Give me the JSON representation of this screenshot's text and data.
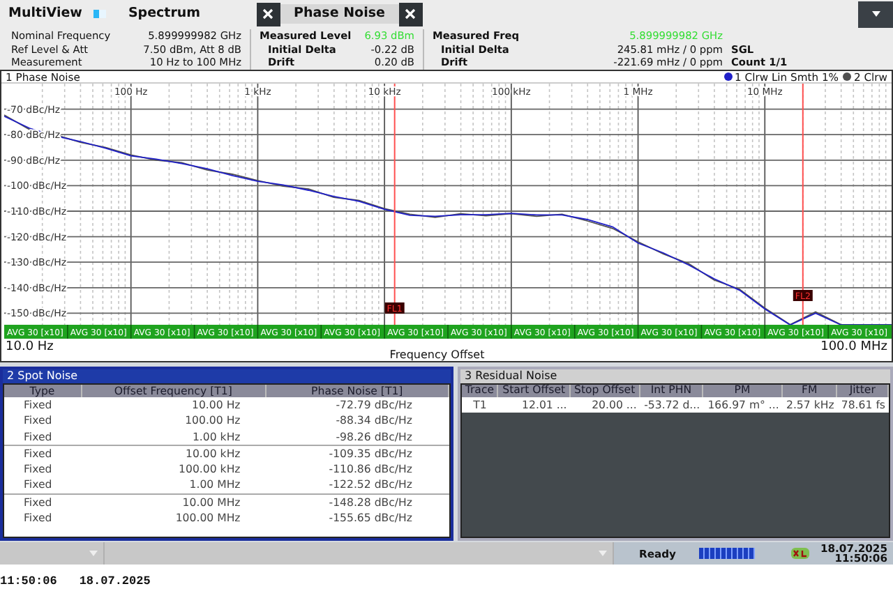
{
  "tab_bar": {
    "title": "MultiView",
    "tabs": [
      {
        "label": "Spectrum",
        "selected": false
      },
      {
        "label": "Phase Noise",
        "selected": true
      }
    ]
  },
  "info_columns": [
    [
      {
        "label": "Nominal Frequency",
        "value": "5.899999982 GHz",
        "highlighted": false
      },
      {
        "label": "Ref Level & Att",
        "value": "7.50 dBm, Att 8 dB",
        "highlighted": false
      },
      {
        "label": "Measurement",
        "value": "10 Hz to 100 MHz",
        "highlighted": false
      }
    ],
    [
      {
        "label": "Measured Level",
        "value": "6.93 dBm",
        "highlighted": true,
        "children": [
          {
            "label": "Initial Delta",
            "value": "-0.22 dB",
            "highlighted": false
          },
          {
            "label": "Drift",
            "value": "0.20 dB",
            "highlighted": false
          }
        ]
      }
    ],
    [
      {
        "label": "Measured Freq",
        "value": "5.899999982 GHz",
        "highlighted": true,
        "children": [
          {
            "label": "Initial Delta",
            "value": "245.81 mHz / 0 ppm",
            "highlighted": false
          },
          {
            "label": "Drift",
            "value": "-221.69 mHz / 0 ppm",
            "highlighted": false
          }
        ]
      }
    ],
    [
      {
        "label": "SGL"
      },
      {
        "label": "Count 1/1"
      }
    ]
  ],
  "phase_noise_window": {
    "title": "1 Phase Noise",
    "start_label": "10.0 Hz",
    "stop_label": "100.0 MHz",
    "average_labels": [
      "AVG 30 [x10]",
      "AVG 30 [x10]",
      "AVG 30 [x10]",
      "AVG 30 [x10]",
      "AVG 30 [x10]",
      "AVG 30 [x10]",
      "AVG 30 [x10]",
      "AVG 30 [x10]",
      "AVG 30 [x10]",
      "AVG 30 [x10]",
      "AVG 30 [x10]",
      "AVG 30 [x10]",
      "AVG 30 [x10]",
      "AVG 30 [x10]"
    ],
    "chart_data": {
      "type": "line",
      "xlabel": "Frequency Offset",
      "categories": [
        null,
        null,
        null,
        null,
        null,
        "100 Hz",
        null,
        null,
        null,
        null,
        "1 kHz",
        null,
        null,
        null,
        null,
        "10 kHz",
        null,
        null,
        null,
        null,
        "100 kHz",
        null,
        null,
        null,
        null,
        "1 MHz",
        null,
        null,
        null,
        null,
        "10 MHz",
        null,
        null,
        null,
        null,
        null
      ],
      "series": [
        {
          "name": "1 Clrw Lin Smth 1%",
          "color": "#2020c8",
          "values": [
            -72.8,
            -77.5,
            -80.5,
            -82.7,
            -85.3,
            -88.3,
            -89.6,
            -91.3,
            -93.4,
            -96,
            -98.3,
            -99.7,
            -101.8,
            -104.2,
            -106.1,
            -109.3,
            -111.6,
            -112,
            -111.4,
            -111.4,
            -110.9,
            -111.5,
            -111.5,
            -113.3,
            -116.2,
            -122.5,
            -126.4,
            -131.1,
            -136.5,
            -141,
            -148.3,
            -154.6,
            -150,
            -154.6,
            -154.6,
            -154.6
          ]
        },
        {
          "name": "2 Clrw",
          "color": "#505050",
          "values": [
            -72.3,
            -78,
            -80,
            -83,
            -85,
            -88,
            -90,
            -91,
            -93.8,
            -95.5,
            -98,
            -100.2,
            -101.3,
            -104.6,
            -105.8,
            -109,
            -111.2,
            -112.4,
            -111,
            -111.8,
            -111,
            -112,
            -111.2,
            -113.8,
            -116.8,
            -122,
            -126.8,
            -130.6,
            -137,
            -140.6,
            -148,
            -154.5,
            -149.5,
            -154.5,
            -154.5,
            -154.5
          ]
        }
      ],
      "ylim": [
        -160,
        -60
      ],
      "grid": true,
      "yticks": [
        {
          "value": -70,
          "label": "-70 dBc/Hz"
        },
        {
          "value": -80,
          "label": "-80 dBc/Hz"
        },
        {
          "value": -90,
          "label": "-90 dBc/Hz"
        },
        {
          "value": -100,
          "label": "-100 dBc/Hz"
        },
        {
          "value": -110,
          "label": "-110 dBc/Hz"
        },
        {
          "value": -120,
          "label": "-120 dBc/Hz"
        },
        {
          "value": -130,
          "label": "-130 dBc/Hz"
        },
        {
          "value": -140,
          "label": "-140 dBc/Hz"
        },
        {
          "value": -150,
          "label": "-150 dBc/Hz"
        }
      ],
      "annotations": [
        "FL1",
        "FL2"
      ]
    }
  },
  "spot_noise_window": {
    "title": "2 Spot Noise",
    "active": true,
    "columns": [
      "Type",
      "Offset Frequency [T1]",
      "Phase Noise [T1]"
    ],
    "rows": [
      [
        "Fixed",
        "10.00 Hz",
        "-72.79 dBc/Hz"
      ],
      [
        "Fixed",
        "100.00 Hz",
        "-88.34 dBc/Hz"
      ],
      [
        "Fixed",
        "1.00 kHz",
        "-98.26 dBc/Hz"
      ],
      [
        "Fixed",
        "10.00 kHz",
        "-109.35 dBc/Hz"
      ],
      [
        "Fixed",
        "100.00 kHz",
        "-110.86 dBc/Hz"
      ],
      [
        "Fixed",
        "1.00 MHz",
        "-122.52 dBc/Hz"
      ],
      [
        "Fixed",
        "10.00 MHz",
        "-148.28 dBc/Hz"
      ],
      [
        "Fixed",
        "100.00 MHz",
        "-155.65 dBc/Hz"
      ]
    ]
  },
  "residual_noise_window": {
    "title": "3 Residual Noise",
    "active": false,
    "columns": [
      "Trace",
      "Start Offset",
      "Stop Offset",
      "Int PHN",
      "PM",
      "FM",
      "Jitter"
    ],
    "rows": [
      [
        "T1",
        "12.01 ...",
        "20.00 ...",
        "-53.72 d...",
        "166.97 m° ...",
        "2.57 kHz",
        "78.61 fs"
      ]
    ]
  },
  "status_bar": {
    "state": "Ready",
    "progress": {
      "level": 1
    },
    "date": "18.07.2025",
    "time": "11:50:06"
  },
  "timestamp": {
    "time": "11:50:06",
    "date": "18.07.2025"
  }
}
